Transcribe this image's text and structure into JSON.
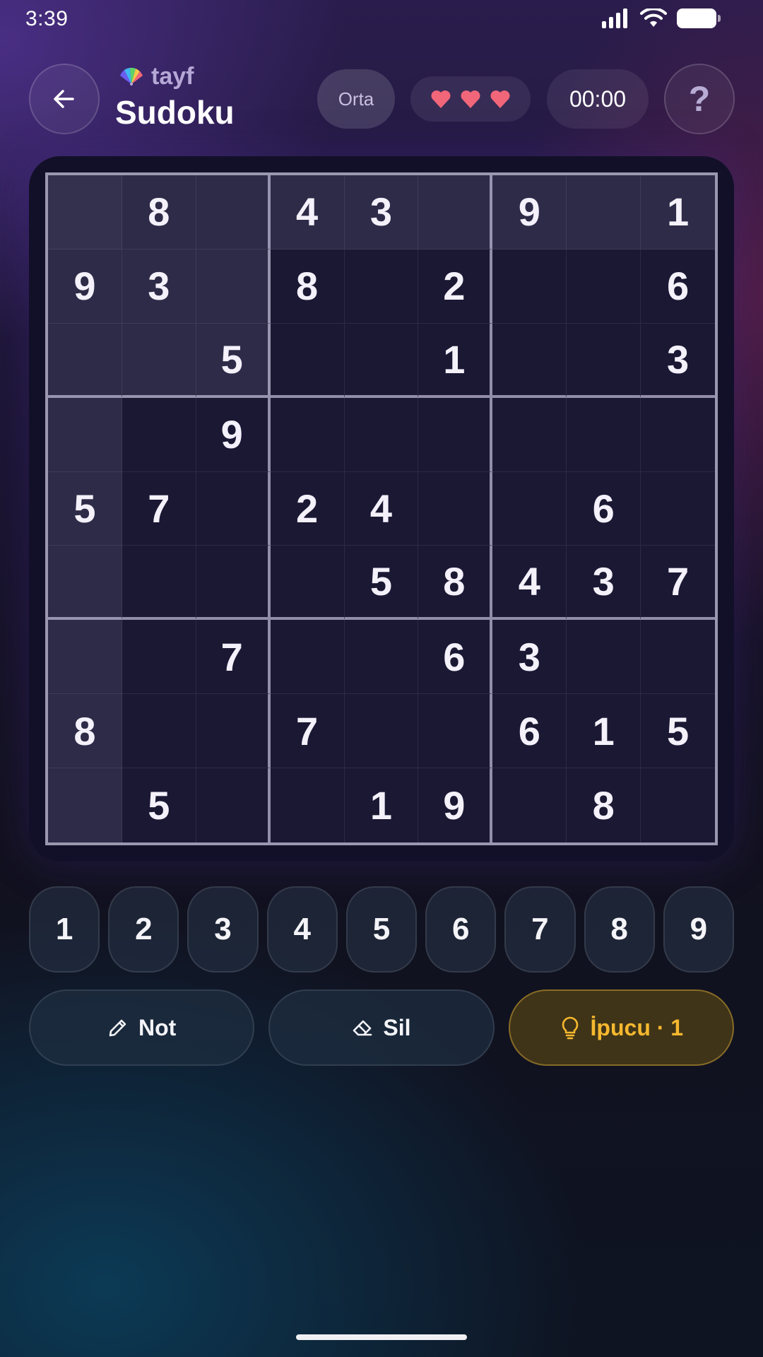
{
  "status_bar": {
    "time": "3:39"
  },
  "header": {
    "brand": "tayf",
    "title": "Sudoku",
    "difficulty": "Orta",
    "lives": 3,
    "timer": "00:00",
    "help_label": "?"
  },
  "board": {
    "rows": [
      [
        "",
        "8",
        "",
        "4",
        "3",
        "",
        "9",
        "",
        "1"
      ],
      [
        "9",
        "3",
        "",
        "8",
        "",
        "2",
        "",
        "",
        "6"
      ],
      [
        "",
        "",
        "5",
        "",
        "",
        "1",
        "",
        "",
        "3"
      ],
      [
        "",
        "",
        "9",
        "",
        "",
        "",
        "",
        "",
        ""
      ],
      [
        "5",
        "7",
        "",
        "2",
        "4",
        "",
        "",
        "6",
        ""
      ],
      [
        "",
        "",
        "",
        "",
        "5",
        "8",
        "4",
        "3",
        "7"
      ],
      [
        "",
        "",
        "7",
        "",
        "",
        "6",
        "3",
        "",
        ""
      ],
      [
        "8",
        "",
        "",
        "7",
        "",
        "",
        "6",
        "1",
        "5"
      ],
      [
        "",
        "5",
        "",
        "",
        "1",
        "9",
        "",
        "8",
        ""
      ]
    ],
    "selected_cell": {
      "row": 0,
      "col": 0
    }
  },
  "numpad": [
    "1",
    "2",
    "3",
    "4",
    "5",
    "6",
    "7",
    "8",
    "9"
  ],
  "actions": {
    "note_label": "Not",
    "erase_label": "Sil",
    "hint_label": "İpucu · 1"
  },
  "colors": {
    "accent_hint": "#f6b82e",
    "heart": "#f2667a",
    "highlight": "#2e2b48"
  }
}
